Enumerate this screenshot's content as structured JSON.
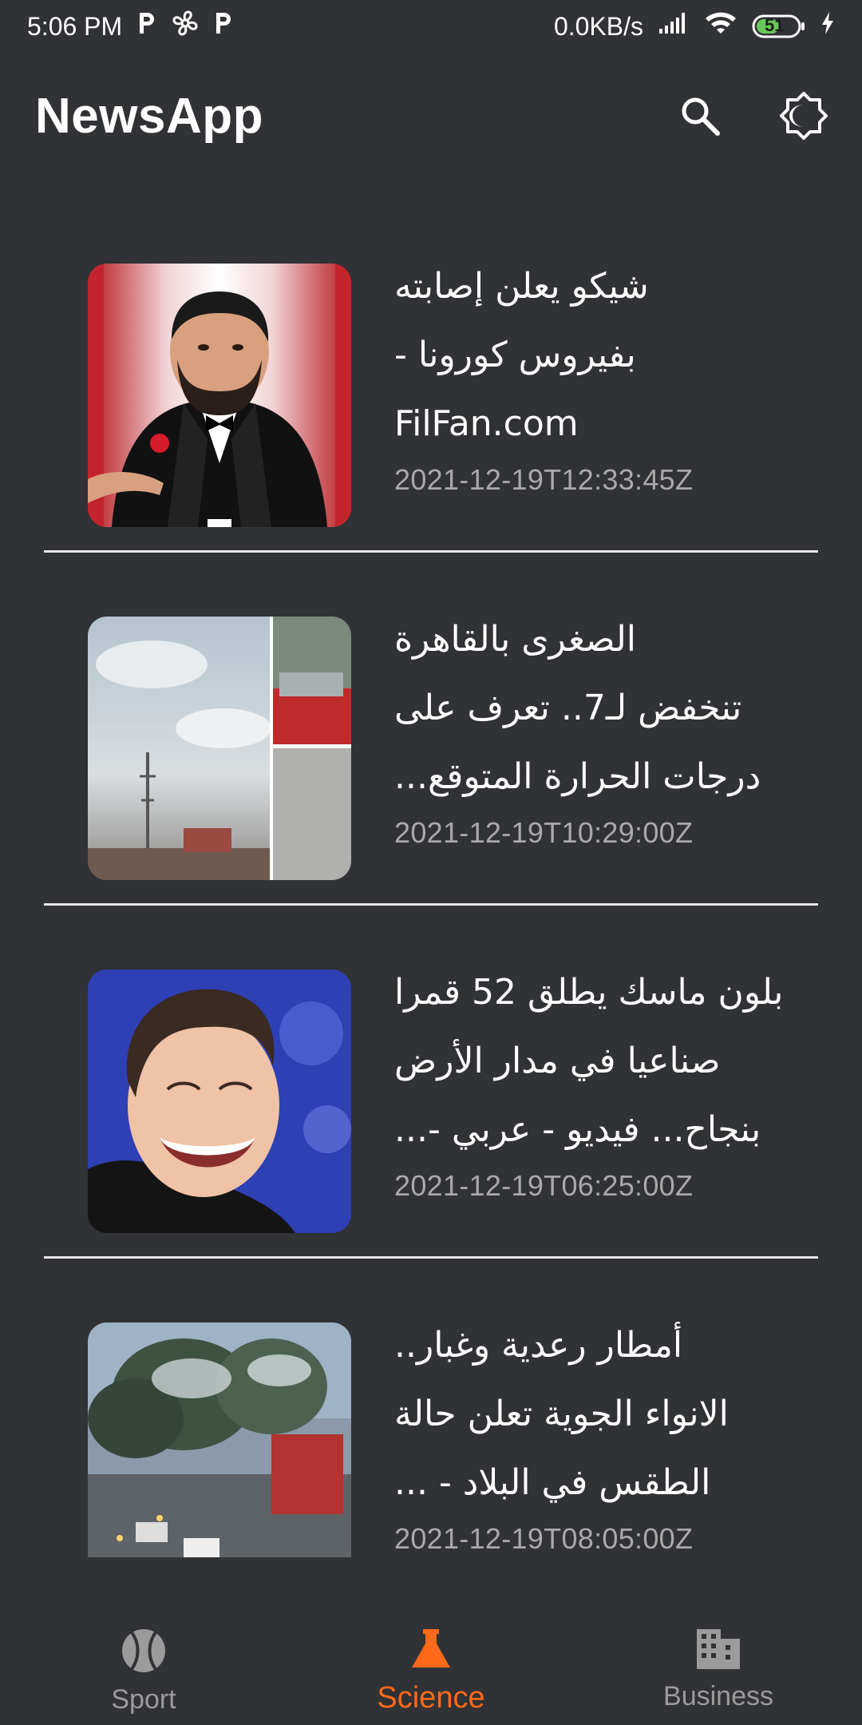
{
  "status_bar": {
    "time": "5:06 PM",
    "left_icons": [
      "p-icon",
      "fan-icon",
      "p-icon"
    ],
    "network_speed": "0.0KB/s",
    "battery": "51"
  },
  "app_bar": {
    "title": "NewsApp",
    "search_icon": "search-icon",
    "theme_icon": "brightness-icon"
  },
  "articles": [
    {
      "headline_lines": [
        "شيكو يعلن إصابته",
        "بفيروس كورونا -",
        "FilFan.com"
      ],
      "timestamp": "2021-12-19T12:33:45Z"
    },
    {
      "headline_lines": [
        "الصغرى بالقاهرة",
        "تنخفض لـ7.. تعرف على",
        "درجات الحرارة المتوقع..."
      ],
      "timestamp": "2021-12-19T10:29:00Z"
    },
    {
      "headline_lines": [
        "بلون ماسك يطلق 52 قمرا",
        "صناعيا في مدار الأرض",
        "بنجاح... فيديو - عربي -..."
      ],
      "timestamp": "2021-12-19T06:25:00Z"
    },
    {
      "headline_lines": [
        "أمطار رعدية وغبار..",
        "الانواء الجوية تعلن حالة",
        "الطقس في البلاد - ..."
      ],
      "timestamp": "2021-12-19T08:05:00Z"
    }
  ],
  "bottom_nav": {
    "items": [
      {
        "label": "Sport",
        "icon": "baseball-icon",
        "active": false
      },
      {
        "label": "Science",
        "icon": "flask-icon",
        "active": true
      },
      {
        "label": "Business",
        "icon": "building-icon",
        "active": false
      }
    ]
  },
  "colors": {
    "background": "#303235",
    "accent": "#ff6a1a",
    "inactive": "#9b9b9b",
    "timestamp": "#a9a9a9"
  }
}
